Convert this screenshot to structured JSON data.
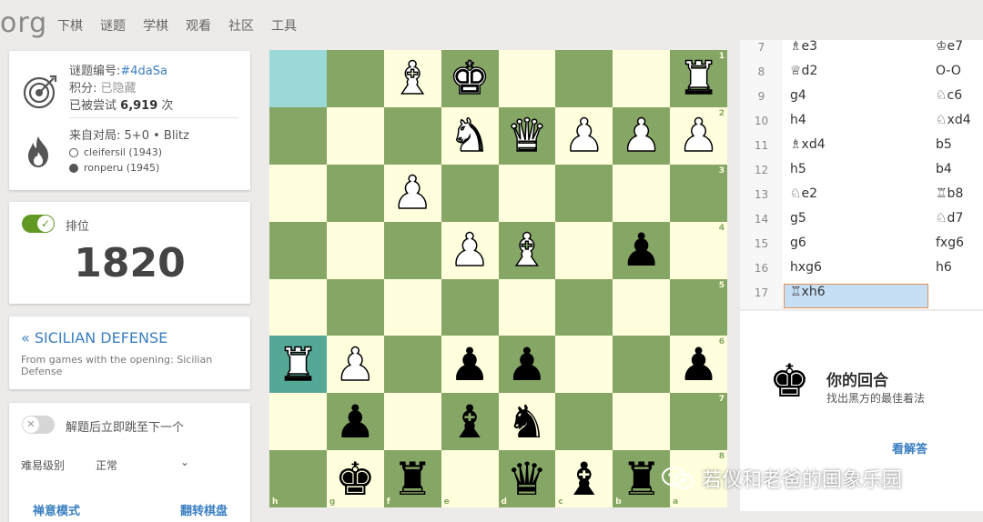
{
  "site": {
    "logo": "org"
  },
  "nav": [
    "下棋",
    "谜题",
    "学棋",
    "观看",
    "社区",
    "工具"
  ],
  "puzzle": {
    "id_label": "谜题编号:",
    "id": "#4daSa",
    "score_label": "积分:",
    "score": "已隐藏",
    "attempts_prefix": "已被尝试",
    "attempts": "6,919",
    "attempts_suffix": "次",
    "game_label": "来自对局:",
    "game": "5+0 • Blitz",
    "white_player": "cleifersil (1943)",
    "black_player": "ronperu (1945)"
  },
  "rating": {
    "label": "排位",
    "value": "1820"
  },
  "theme": {
    "name": "« SICILIAN DEFENSE",
    "desc": "From games with the opening: Sicilian Defense"
  },
  "settings": {
    "jump_label": "解题后立即跳至下一个",
    "difficulty_label": "难易级别",
    "difficulty_value": "正常",
    "zen_mode": "禅意模式",
    "flip_board": "翻转棋盘"
  },
  "board": {
    "colors": {
      "light": "#ffffdd",
      "dark": "#86a666",
      "highlight_light": "#9bd8d6",
      "highlight_dark": "#56a896"
    },
    "rows": [
      [
        "",
        "",
        "wB",
        "wK",
        "",
        "",
        "",
        "wR"
      ],
      [
        "",
        "",
        "",
        "wN",
        "wQ",
        "wP",
        "wP",
        "wP"
      ],
      [
        "",
        "",
        "wP",
        "",
        "",
        "",
        "",
        ""
      ],
      [
        "",
        "",
        "",
        "wP",
        "wB",
        "",
        "bP",
        ""
      ],
      [
        "",
        "",
        "",
        "",
        "",
        "",
        "",
        ""
      ],
      [
        "wR",
        "wP",
        "",
        "bP",
        "bP",
        "",
        "",
        "bP"
      ],
      [
        "",
        "bP",
        "",
        "bB",
        "bN",
        "",
        "",
        ""
      ],
      [
        "",
        "bK",
        "bR",
        "",
        "bQ",
        "bB",
        "bR",
        ""
      ]
    ],
    "ranks": [
      "1",
      "2",
      "3",
      "4",
      "5",
      "6",
      "7",
      "8"
    ],
    "files": [
      "h",
      "g",
      "f",
      "e",
      "d",
      "c",
      "b",
      "a"
    ]
  },
  "moves": [
    {
      "n": "7",
      "w": "♗e3",
      "b": "♔e7"
    },
    {
      "n": "8",
      "w": "♕d2",
      "b": "O-O"
    },
    {
      "n": "9",
      "w": "g4",
      "b": "♘c6"
    },
    {
      "n": "10",
      "w": "h4",
      "b": "♘xd4"
    },
    {
      "n": "11",
      "w": "♗xd4",
      "b": "b5"
    },
    {
      "n": "12",
      "w": "h5",
      "b": "b4"
    },
    {
      "n": "13",
      "w": "♘e2",
      "b": "♖b8"
    },
    {
      "n": "14",
      "w": "g5",
      "b": "♘d7"
    },
    {
      "n": "15",
      "w": "g6",
      "b": "fxg6"
    },
    {
      "n": "16",
      "w": "hxg6",
      "b": "h6"
    },
    {
      "n": "17",
      "w": "♖xh6",
      "b": ""
    }
  ],
  "turn": {
    "title": "你的回合",
    "subtitle": "找出黑方的最佳着法",
    "solution": "看解答"
  },
  "watermark": "若仪和老爸的国象乐园"
}
